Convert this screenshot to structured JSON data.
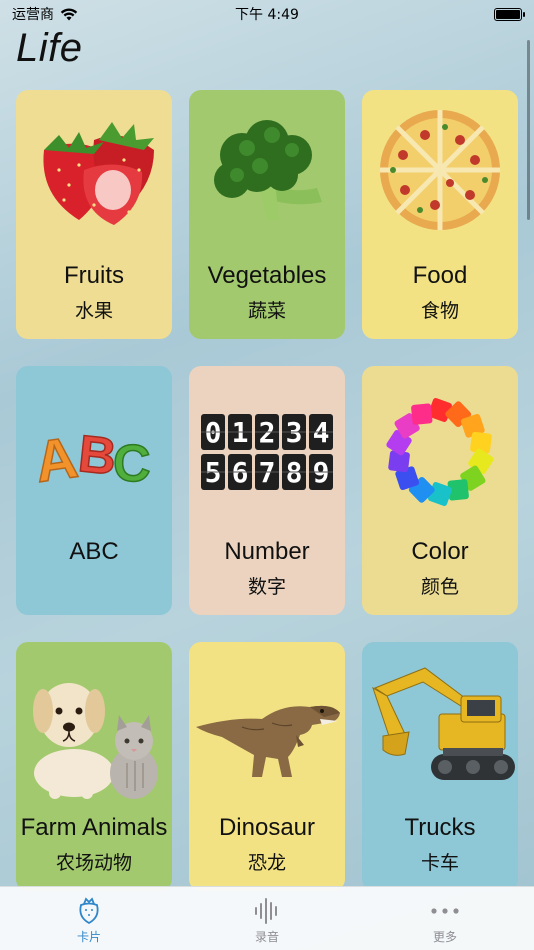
{
  "status_bar": {
    "carrier": "运营商",
    "time": "下午 4:49",
    "battery_level": 1.0
  },
  "app": {
    "title": "Life"
  },
  "cards": [
    {
      "en": "Fruits",
      "zh": "水果",
      "color": "#eedd92",
      "icon": "strawberry-icon"
    },
    {
      "en": "Vegetables",
      "zh": "蔬菜",
      "color": "#a3c96e",
      "icon": "broccoli-icon"
    },
    {
      "en": "Food",
      "zh": "食物",
      "color": "#f2e283",
      "icon": "pizza-icon"
    },
    {
      "en": "ABC",
      "zh": "",
      "color": "#8ec7d6",
      "icon": "abc-letters-icon"
    },
    {
      "en": "Number",
      "zh": "数字",
      "color": "#ebd3c0",
      "icon": "number-digits-icon",
      "digits_row1": "01234",
      "digits_row2": "56789"
    },
    {
      "en": "Color",
      "zh": "颜色",
      "color": "#ecdc92",
      "icon": "color-wheel-icon"
    },
    {
      "en": "Farm Animals",
      "zh": "农场动物",
      "color": "#a3c96e",
      "icon": "dog-cat-icon"
    },
    {
      "en": "Dinosaur",
      "zh": "恐龙",
      "color": "#f2e283",
      "icon": "dinosaur-icon"
    },
    {
      "en": "Trucks",
      "zh": "卡车",
      "color": "#8ec7d6",
      "icon": "excavator-icon"
    }
  ],
  "tab_bar": {
    "tabs": [
      {
        "label": "卡片",
        "icon": "strawberry-outline-icon",
        "active": true
      },
      {
        "label": "录音",
        "icon": "waveform-icon",
        "active": false
      },
      {
        "label": "更多",
        "icon": "more-dots-icon",
        "active": false
      }
    ],
    "active_color": "#2f86c9",
    "inactive_color": "#8e8e93"
  }
}
